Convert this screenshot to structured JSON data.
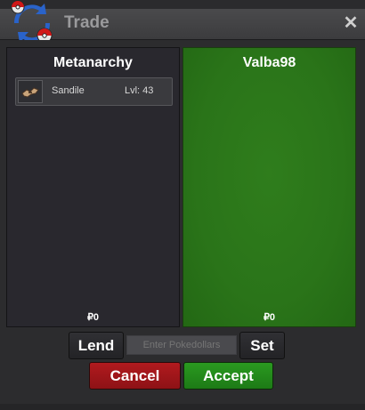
{
  "window": {
    "title": "Trade",
    "close_label": "✕"
  },
  "left_panel": {
    "player_name": "Metanarchy",
    "items": [
      {
        "name": "Sandile",
        "level": "Lvl: 43",
        "icon": "sandile-icon"
      }
    ],
    "money": "₽0"
  },
  "right_panel": {
    "player_name": "Valba98",
    "money": "₽0",
    "accent_color": "#2a7419"
  },
  "controls": {
    "lend_label": "Lend",
    "money_placeholder": "Enter Pokedollars",
    "set_label": "Set",
    "cancel_label": "Cancel",
    "accept_label": "Accept"
  },
  "colors": {
    "cancel": "#a0161a",
    "accept": "#238a1a",
    "panel_dark": "#29282e"
  }
}
